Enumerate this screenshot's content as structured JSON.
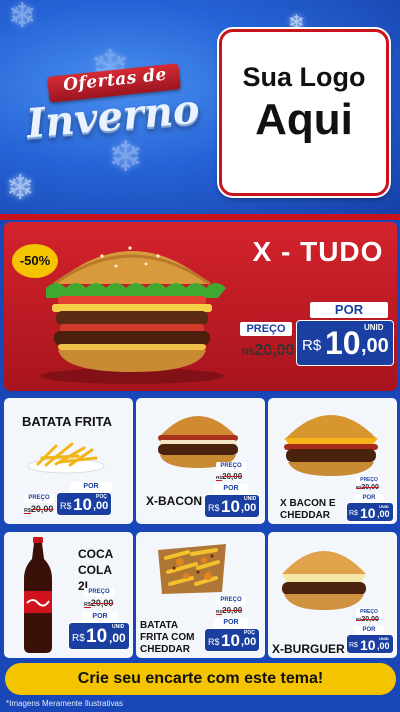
{
  "header": {
    "title_top": "Ofertas de",
    "title_main": "Inverno",
    "logo_line1": "Sua Logo",
    "logo_line2": "Aqui"
  },
  "feature": {
    "discount": "-50%",
    "name": "X - TUDO",
    "preco_label": "PREÇO",
    "old_currency": "R$",
    "old_price": "20,00",
    "por_label": "POR",
    "currency": "R$",
    "price_int": "10",
    "price_dec": ",00",
    "unit": "UNID"
  },
  "products": [
    {
      "name": "BATATA FRITA",
      "preco_label": "PREÇO",
      "old_currency": "R$",
      "old_price": "20,00",
      "por_label": "POR",
      "currency": "R$",
      "price_int": "10",
      "price_dec": ",00",
      "unit": "POÇ"
    },
    {
      "name": "X-BACON",
      "preco_label": "PREÇO",
      "old_currency": "R$",
      "old_price": "20,00",
      "por_label": "POR",
      "currency": "R$",
      "price_int": "10",
      "price_dec": ",00",
      "unit": "UNID"
    },
    {
      "name": "X BACON E CHEDDAR",
      "preco_label": "PREÇO",
      "old_currency": "R$",
      "old_price": "20,00",
      "por_label": "POR",
      "currency": "R$",
      "price_int": "10",
      "price_dec": ",00",
      "unit": "UNID"
    },
    {
      "name": "COCA COLA 2L",
      "preco_label": "PREÇO",
      "old_currency": "R$",
      "old_price": "20,00",
      "por_label": "POR",
      "currency": "R$",
      "price_int": "10",
      "price_dec": ",00",
      "unit": "UNID"
    },
    {
      "name": "BATATA FRITA COM CHEDDAR",
      "preco_label": "PREÇO",
      "old_currency": "R$",
      "old_price": "20,00",
      "por_label": "POR",
      "currency": "R$",
      "price_int": "10",
      "price_dec": ",00",
      "unit": "POÇ"
    },
    {
      "name": "X-BURGUER",
      "preco_label": "PREÇO",
      "old_currency": "R$",
      "old_price": "20,00",
      "por_label": "POR",
      "currency": "R$",
      "price_int": "10",
      "price_dec": ",00",
      "unit": "UNID"
    }
  ],
  "cta": "Crie seu encarte com este tema!",
  "footer_note": "*Imagens Meramente Ilustrativas",
  "colors": {
    "brand_red": "#c8121c",
    "brand_blue": "#1a3fa0",
    "accent_yellow": "#f5c400"
  },
  "icons": [
    "snowflake-icon",
    "burger-image",
    "fries-image",
    "coca-cola-bottle-image",
    "cheddar-fries-image"
  ]
}
